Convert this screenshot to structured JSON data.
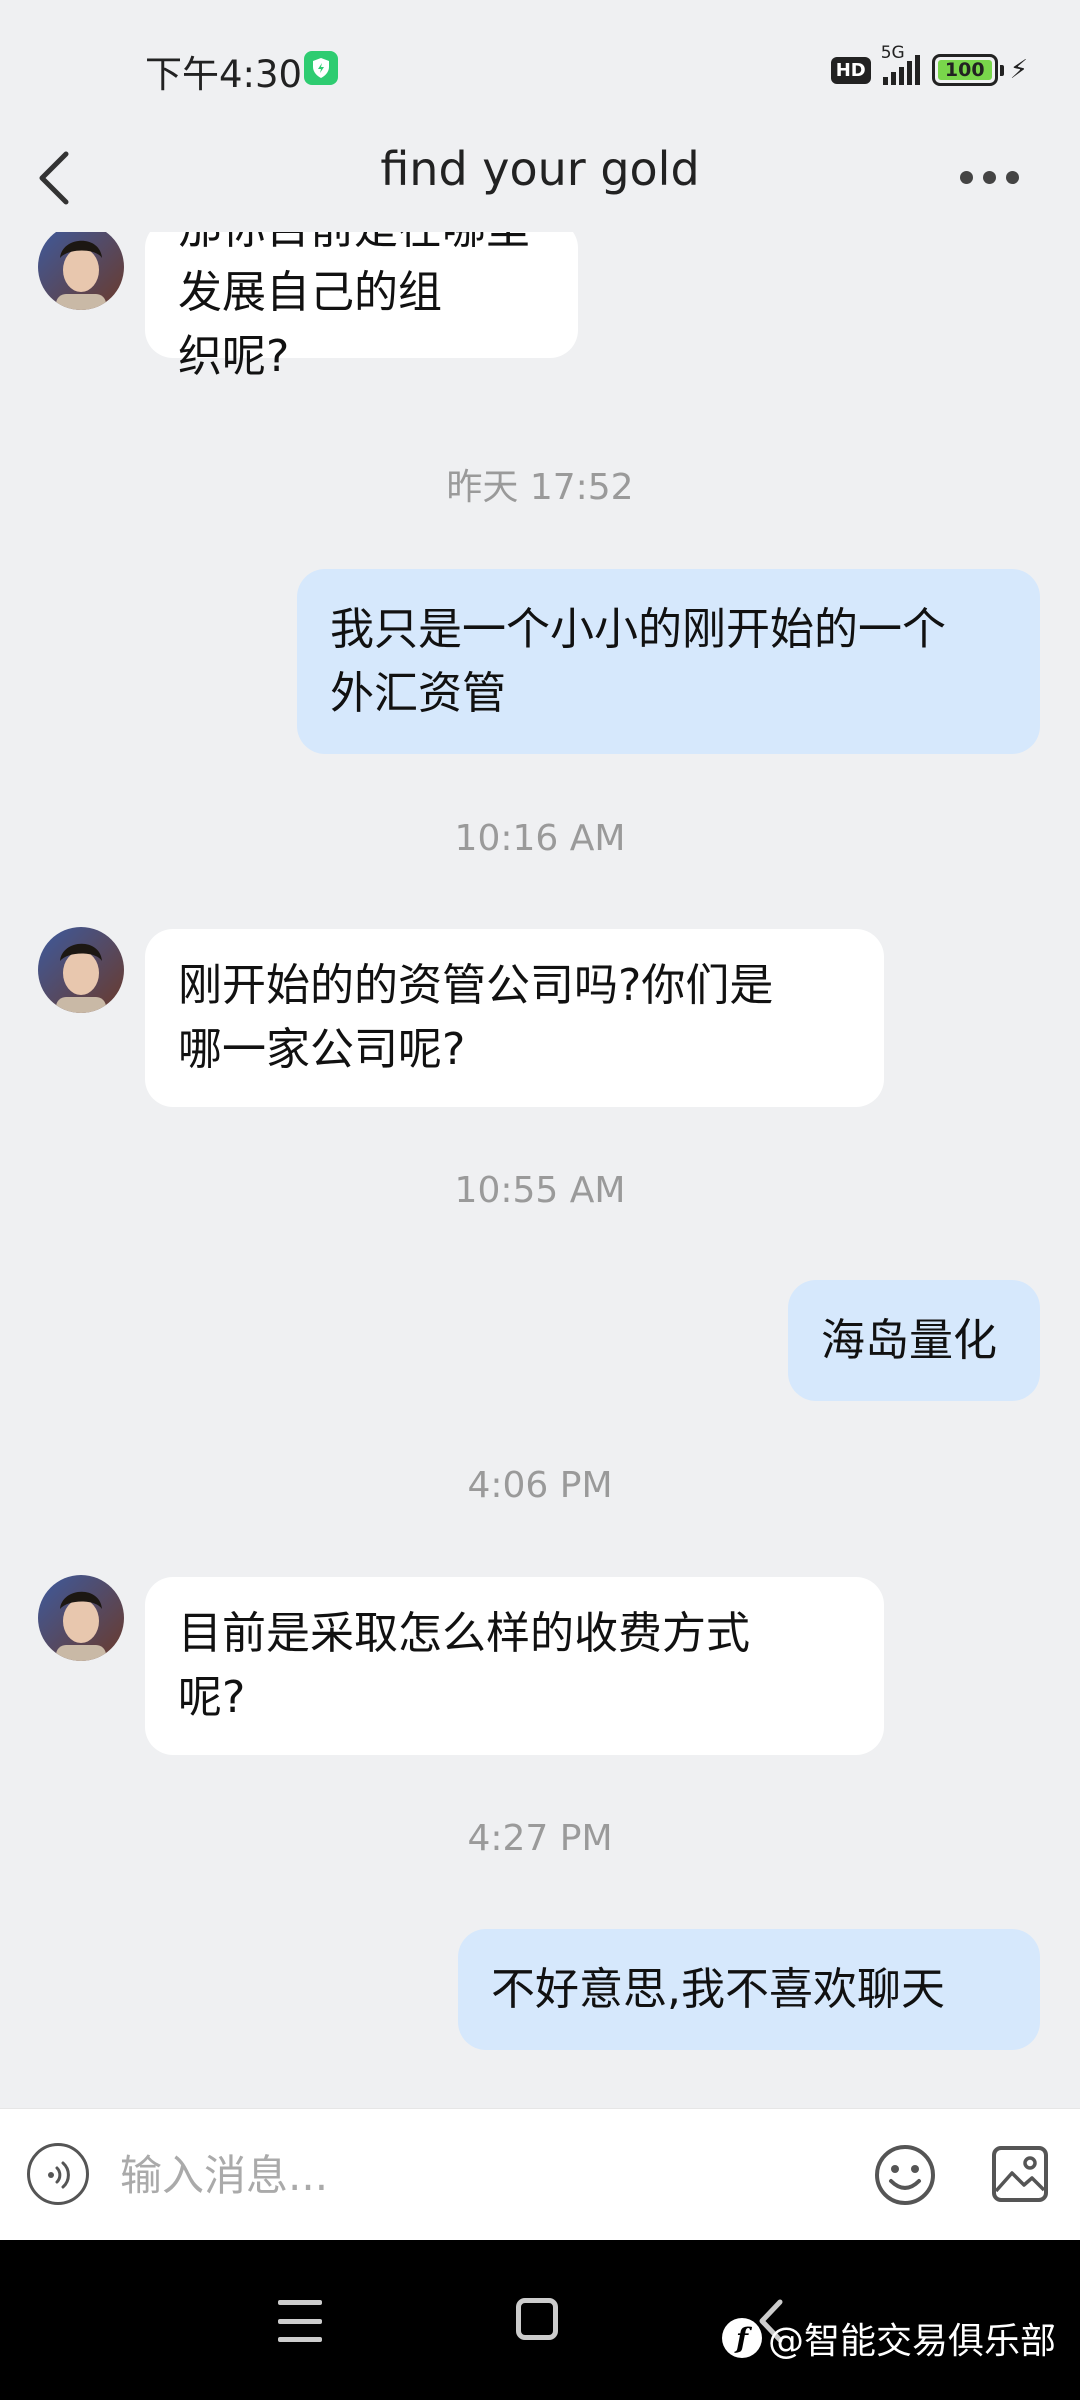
{
  "status_bar": {
    "time": "下午4:30",
    "hd": "HD",
    "network": "5G",
    "battery": "100",
    "icons": [
      "shield-icon",
      "signal-icon",
      "battery-icon",
      "charging-bolt-icon"
    ]
  },
  "header": {
    "title": "find your gold",
    "icons": [
      "back-arrow-icon",
      "more-dots-icon"
    ]
  },
  "messages": [
    {
      "side": "in",
      "lines": [
        "那你目前是在哪里发展自己的组",
        "织呢?"
      ]
    },
    {
      "type": "timestamp",
      "text": "昨天 17:52"
    },
    {
      "side": "out",
      "lines": [
        "我只是一个小小的刚开始的一个",
        "外汇资管"
      ]
    },
    {
      "type": "timestamp",
      "text": "10:16 AM"
    },
    {
      "side": "in",
      "lines": [
        "刚开始的的资管公司吗?你们是",
        "哪一家公司呢?"
      ]
    },
    {
      "type": "timestamp",
      "text": "10:55 AM"
    },
    {
      "side": "out",
      "lines": [
        "海岛量化"
      ]
    },
    {
      "type": "timestamp",
      "text": "4:06 PM"
    },
    {
      "side": "in",
      "lines": [
        "目前是采取怎么样的收费方式",
        "呢?"
      ]
    },
    {
      "type": "timestamp",
      "text": "4:27 PM"
    },
    {
      "side": "out",
      "lines": [
        "不好意思,我不喜欢聊天"
      ]
    }
  ],
  "input": {
    "placeholder": "输入消息...",
    "icons": [
      "voice-icon",
      "emoji-icon",
      "image-icon"
    ]
  },
  "watermark": {
    "logo": "f",
    "text": "@智能交易俱乐部"
  },
  "colors": {
    "background": "#eff0f2",
    "incoming_bubble": "#ffffff",
    "outgoing_bubble": "#d6e8fc",
    "timestamp": "#9a9a9a",
    "battery_fill": "#79d64b"
  }
}
